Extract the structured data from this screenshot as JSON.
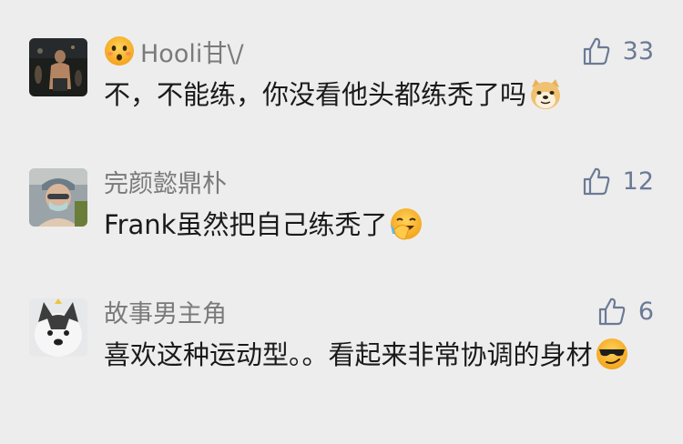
{
  "comments": [
    {
      "name_prefix_icon": "surprised-face-emoji",
      "username": "Hooli甘\\/",
      "likes": "33",
      "text": "不，不能练，你没看他头都练秃了吗",
      "trailing_emoji": "doge-emoji"
    },
    {
      "username": "完颜懿鼎朴",
      "likes": "12",
      "text": "Frank虽然把自己练秃了",
      "trailing_emoji": "facepalm-laugh-emoji"
    },
    {
      "username": "故事男主角",
      "likes": "6",
      "text": "喜欢这种运动型。。看起来非常协调的身材",
      "trailing_emoji": "sunglasses-smirk-emoji"
    }
  ],
  "colors": {
    "background": "#ededed",
    "username": "#7a7a7a",
    "like_accent": "#6b7a95",
    "text": "#1a1a1a"
  }
}
